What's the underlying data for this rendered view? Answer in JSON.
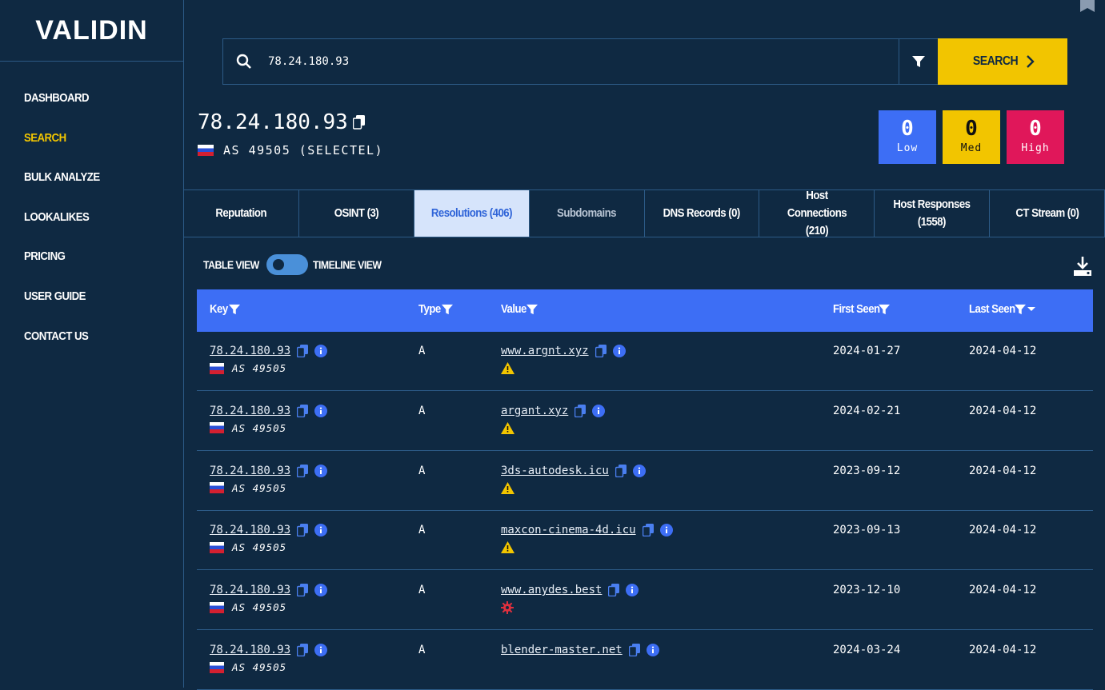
{
  "app": {
    "logo": "VALIDIN"
  },
  "sidebar": {
    "items": [
      {
        "label": "DASHBOARD"
      },
      {
        "label": "SEARCH",
        "active": true
      },
      {
        "label": "BULK ANALYZE"
      },
      {
        "label": "LOOKALIKES"
      },
      {
        "label": "PRICING"
      },
      {
        "label": "USER GUIDE"
      },
      {
        "label": "CONTACT US"
      }
    ]
  },
  "search": {
    "value": "78.24.180.93",
    "button_label": "SEARCH"
  },
  "header": {
    "ip": "78.24.180.93",
    "asn": "AS 49505 (SELECTEL)",
    "country": "RU"
  },
  "badges": [
    {
      "count": "0",
      "label": "Low",
      "color": "#3d6ef5"
    },
    {
      "count": "0",
      "label": "Med",
      "color": "#f2c500"
    },
    {
      "count": "0",
      "label": "High",
      "color": "#e0175a"
    }
  ],
  "tabs": [
    {
      "label": "Reputation"
    },
    {
      "label": "OSINT (3)"
    },
    {
      "label": "Resolutions (406)",
      "active": true
    },
    {
      "label": "Subdomains",
      "dim": true
    },
    {
      "label": "DNS Records (0)"
    },
    {
      "label": "Host Connections (210)"
    },
    {
      "label": "Host Responses (1558)"
    },
    {
      "label": "CT Stream (0)"
    }
  ],
  "view": {
    "left": "TABLE VIEW",
    "right": "TIMELINE VIEW"
  },
  "table": {
    "columns": [
      "Key",
      "Type",
      "Value",
      "First Seen",
      "Last Seen"
    ],
    "rows": [
      {
        "key": "78.24.180.93",
        "asn": "AS 49505",
        "type": "A",
        "value": "www.argnt.xyz",
        "flag": "warning",
        "first": "2024-01-27",
        "last": "2024-04-12"
      },
      {
        "key": "78.24.180.93",
        "asn": "AS 49505",
        "type": "A",
        "value": "argant.xyz",
        "flag": "warning",
        "first": "2024-02-21",
        "last": "2024-04-12"
      },
      {
        "key": "78.24.180.93",
        "asn": "AS 49505",
        "type": "A",
        "value": "3ds-autodesk.icu",
        "flag": "warning",
        "first": "2023-09-12",
        "last": "2024-04-12"
      },
      {
        "key": "78.24.180.93",
        "asn": "AS 49505",
        "type": "A",
        "value": "maxcon-cinema-4d.icu",
        "flag": "warning",
        "first": "2023-09-13",
        "last": "2024-04-12"
      },
      {
        "key": "78.24.180.93",
        "asn": "AS 49505",
        "type": "A",
        "value": "www.anydes.best",
        "flag": "malware",
        "first": "2023-12-10",
        "last": "2024-04-12"
      },
      {
        "key": "78.24.180.93",
        "asn": "AS 49505",
        "type": "A",
        "value": "blender-master.net",
        "flag": "",
        "first": "2024-03-24",
        "last": "2024-04-12"
      }
    ]
  }
}
